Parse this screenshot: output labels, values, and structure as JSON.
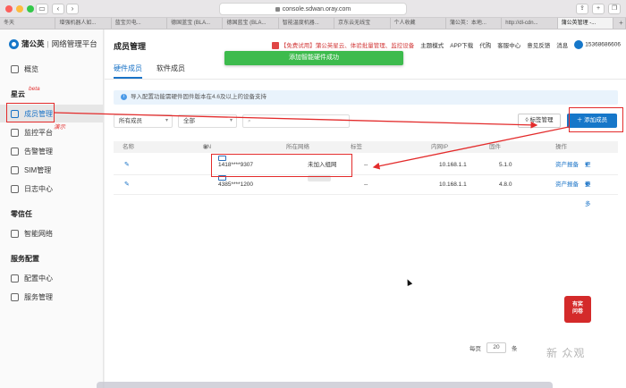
{
  "browser": {
    "address": "console.sdwan.oray.com",
    "tabs": [
      "冬天",
      "增强机器人如...",
      "蓝宝贝电...",
      "德国蓝宝 (BLA...",
      "德国蓝宝 (BLA...",
      "智能温度机器...",
      "京东云无线宝",
      "个人收藏",
      "蒲公英：本地...",
      "http://dl-cdn...",
      "蒲公英管理 -..."
    ]
  },
  "brand": {
    "name": "蒲公英",
    "sub": "网络管理平台"
  },
  "sidebar": {
    "overview": "概览",
    "section_star": "星云",
    "beta": "beta",
    "items_star": [
      "成员管理",
      "监控平台",
      "告警管理",
      "SIM管理",
      "日志中心"
    ],
    "demo": "演示",
    "section_zero": "零信任",
    "items_zero": [
      "智能网络"
    ],
    "section_service": "服务配置",
    "items_service": [
      "配置中心",
      "服务管理"
    ]
  },
  "header": {
    "title": "成员管理",
    "promo": "【免费试用】蒲公英星云、体验批量管理、监控设备",
    "links": [
      "主题模式",
      "APP下载",
      "代购",
      "客服中心",
      "意见反馈",
      "消息"
    ],
    "user": "15368686606"
  },
  "toast": "添加智能硬件成功",
  "subtabs": [
    "硬件成员",
    "软件成员"
  ],
  "notice": "导入配置功能需硬件固件版本在4.6及以上的设备支持",
  "filters": {
    "member": "所有成员",
    "all": "全部",
    "search_placeholder": ""
  },
  "buttons": {
    "tag": "标签管理",
    "add": "添加成员"
  },
  "table": {
    "headers": [
      "名称",
      "SN",
      "所在网络",
      "标签",
      "内网IP",
      "固件",
      "操作"
    ],
    "rows": [
      {
        "sn": "1418****9307",
        "network": "未加入组网",
        "tag": "--",
        "ip": "10.168.1.1",
        "fw": "5.1.0",
        "report": "资产报备",
        "more": "更多"
      },
      {
        "sn": "4385****1200",
        "network": "",
        "tag": "--",
        "ip": "10.168.1.1",
        "fw": "4.8.0",
        "report": "资产报备",
        "more": "更多"
      }
    ]
  },
  "pagination": {
    "label": "每页",
    "size": "20",
    "unit": "条"
  },
  "float_ad": [
    "有奖",
    "问卷"
  ],
  "watermark": "新 众观",
  "colors": {
    "accent": "#1677c9",
    "annotation": "#e32b2b",
    "toast": "#3dbb4d"
  }
}
